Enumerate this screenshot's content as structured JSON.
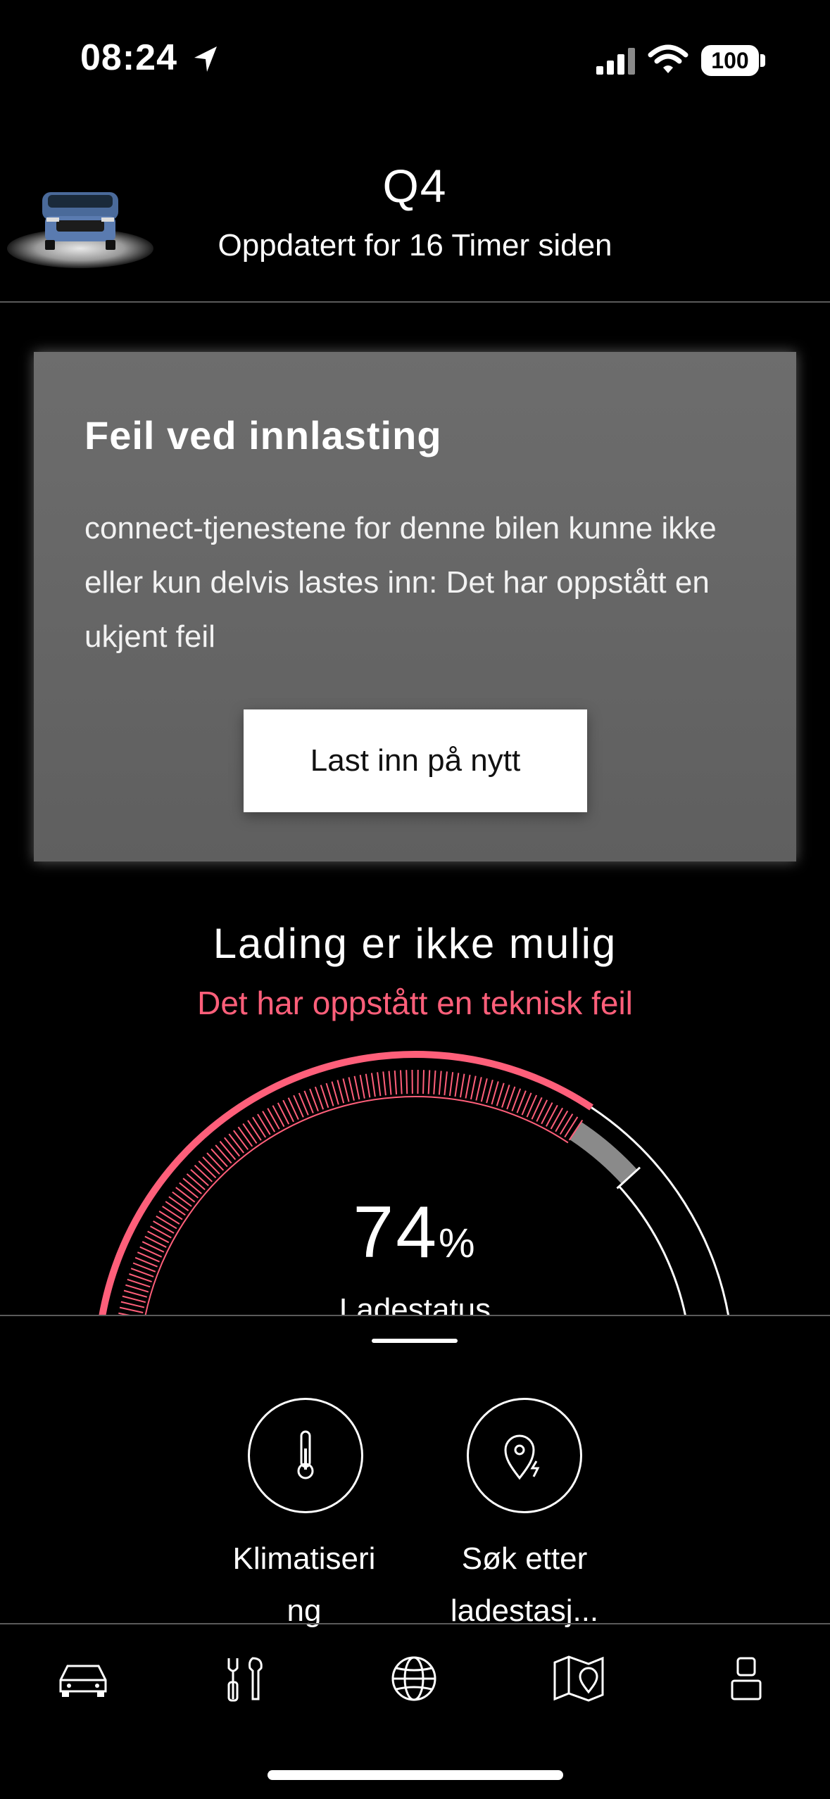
{
  "status_bar": {
    "time": "08:24",
    "battery": "100"
  },
  "header": {
    "model": "Q4",
    "updated": "Oppdatert for 16 Timer siden"
  },
  "error_card": {
    "title": "Feil ved innlasting",
    "body": "connect-tjenestene for denne bilen kunne ikke eller kun delvis lastes inn: Det har oppstått en ukjent feil",
    "reload_label": "Last inn på nytt"
  },
  "charging": {
    "title": "Lading er ikke mulig",
    "subtitle": "Det har oppstått en teknisk feil",
    "value": "74",
    "unit": "%",
    "label": "Ladestatus",
    "level": 0.74,
    "colors": {
      "charge": "#ff5f7a",
      "remaining": "#8a8a8a"
    }
  },
  "actions": [
    {
      "label": "Klimatiseri ng",
      "icon": "thermometer-icon"
    },
    {
      "label": "Søk etter ladestasj...",
      "icon": "charging-location-icon"
    }
  ],
  "tabs": [
    {
      "icon": "car-icon"
    },
    {
      "icon": "tools-icon"
    },
    {
      "icon": "globe-icon"
    },
    {
      "icon": "map-icon"
    },
    {
      "icon": "profile-icon"
    }
  ]
}
